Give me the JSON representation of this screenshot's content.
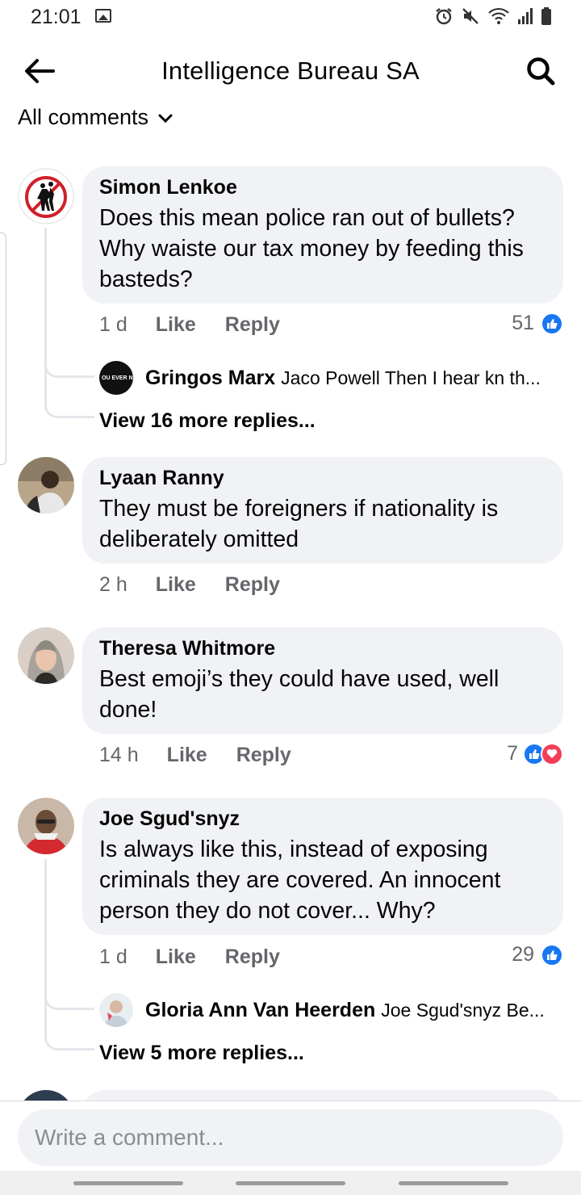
{
  "status_bar": {
    "time": "21:01",
    "icons": [
      "image-icon",
      "alarm-icon",
      "mute-icon",
      "wifi-icon",
      "signal-icon",
      "battery-icon"
    ]
  },
  "header": {
    "title": "Intelligence Bureau SA",
    "back_icon": "arrow-left-icon",
    "search_icon": "search-icon"
  },
  "filter": {
    "label": "All comments",
    "icon": "chevron-down-icon"
  },
  "colors": {
    "bubble_bg": "#f0f2f5",
    "muted_text": "#65676b",
    "like_blue": "#1877f2",
    "love_red": "#f33e58"
  },
  "comments": [
    {
      "author": "Simon Lenkoe",
      "text": "Does this mean police ran out of bullets? Why waiste our tax money by feeding this basteds?",
      "time": "1 d",
      "like_label": "Like",
      "reply_label": "Reply",
      "reaction_count": "51",
      "reactions": [
        "like"
      ],
      "reply_preview": {
        "author": "Gringos Marx",
        "text": "Jaco Powell Then I hear kn th...",
        "avatar_text": "OU EVER N THING. I'M F YOU."
      },
      "view_more": "View 16 more replies..."
    },
    {
      "author": "Lyaan Ranny",
      "text": "They must be foreigners if nationality is deliberately omitted",
      "time": "2 h",
      "like_label": "Like",
      "reply_label": "Reply"
    },
    {
      "author": "Theresa Whitmore",
      "text": "Best emoji’s they could have used, well done!",
      "time": "14 h",
      "like_label": "Like",
      "reply_label": "Reply",
      "reaction_count": "7",
      "reactions": [
        "like",
        "love"
      ]
    },
    {
      "author": "Joe Sgud'snyz",
      "text": "Is always like this, instead of exposing criminals they are covered. An innocent person they do not cover... Why?",
      "time": "1 d",
      "like_label": "Like",
      "reply_label": "Reply",
      "reaction_count": "29",
      "reactions": [
        "like"
      ],
      "reply_preview": {
        "author": "Gloria Ann Van Heerden",
        "text": "Joe Sgud'snyz Be..."
      },
      "view_more": "View 5 more replies..."
    }
  ],
  "composer": {
    "placeholder": "Write a comment..."
  }
}
